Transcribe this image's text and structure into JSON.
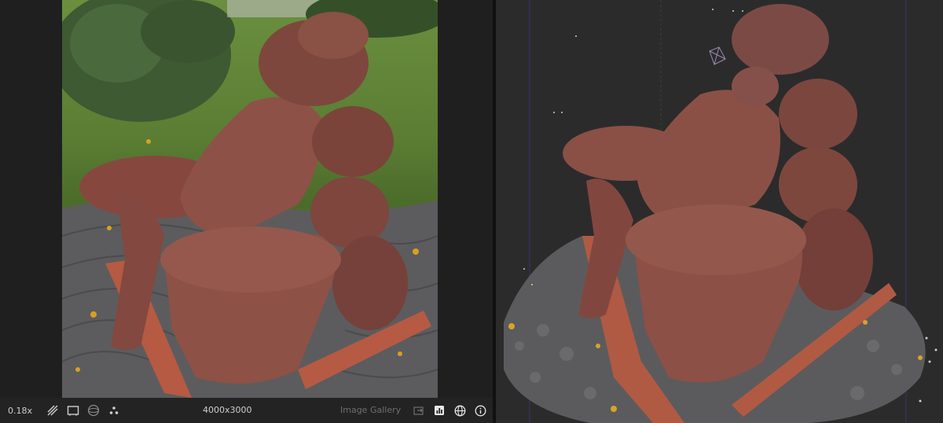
{
  "image_viewer": {
    "zoom_label": "0.18x",
    "resolution_label": "4000x3000",
    "gallery_label": "Image Gallery"
  },
  "icons": {
    "zebra": "zebra-stripes-icon",
    "frame": "frame-icon",
    "sphere": "sphere-icon",
    "features": "features-icon",
    "gallery_export": "gallery-export-icon",
    "histogram": "histogram-icon",
    "globe": "globe-icon",
    "info": "info-icon"
  },
  "colors": {
    "app_bg": "#1e1e1e",
    "viewer3d_bg": "#2b2b2c",
    "statue_terracotta": "#8a4f42",
    "grass": "#5a7d33"
  }
}
